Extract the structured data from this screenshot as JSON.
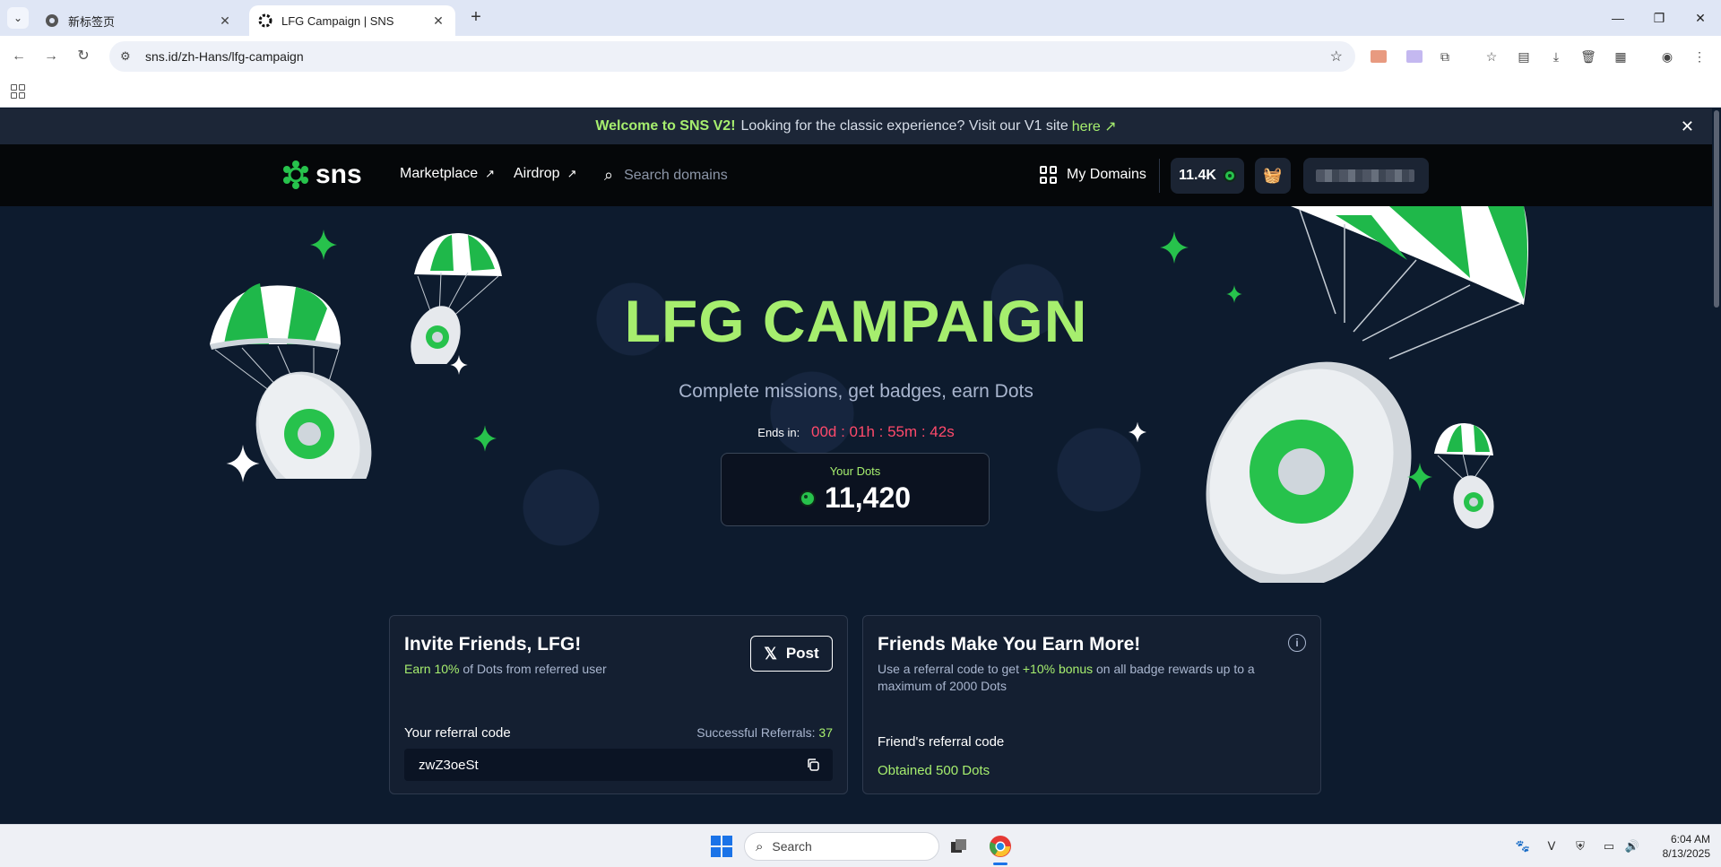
{
  "browser": {
    "tabs": [
      {
        "title": "新标签页",
        "active": false
      },
      {
        "title": "LFG Campaign | SNS",
        "active": true
      }
    ],
    "url": "sns.id/zh-Hans/lfg-campaign"
  },
  "banner": {
    "highlight": "Welcome to SNS V2!",
    "text": "Looking for the classic experience? Visit our V1 site",
    "link": "here"
  },
  "nav": {
    "logo": "sns",
    "marketplace": "Marketplace",
    "airdrop": "Airdrop",
    "search_placeholder": "Search domains",
    "my_domains": "My Domains",
    "dots_balance": "11.4K"
  },
  "hero": {
    "title": "LFG CAMPAIGN",
    "subtitle": "Complete missions, get badges, earn Dots",
    "ends_label": "Ends in:",
    "ends_value": "00d : 01h : 55m : 42s",
    "dots_label": "Your Dots",
    "dots_value": "11,420"
  },
  "invite_card": {
    "title": "Invite Friends, LFG!",
    "earn_highlight": "Earn 10%",
    "earn_rest": " of Dots from referred user",
    "post_label": "Post",
    "referral_label": "Your referral code",
    "successful_label": "Successful Referrals: ",
    "successful_count": "37",
    "referral_code": "zwZ3oeSt"
  },
  "friends_card": {
    "title": "Friends Make You Earn More!",
    "desc_a": "Use a referral code to get ",
    "desc_highlight": "+10% bonus",
    "desc_b": " on all badge rewards up to a maximum of 2000 Dots",
    "friend_code_label": "Friend's referral code",
    "obtained": "Obtained 500 Dots"
  },
  "taskbar": {
    "search": "Search",
    "time": "6:04 AM",
    "date": "8/13/2025"
  },
  "colors": {
    "accent_green": "#a6ee6e",
    "countdown_red": "#ff4a6b",
    "page_bg": "#0d1b2e"
  }
}
